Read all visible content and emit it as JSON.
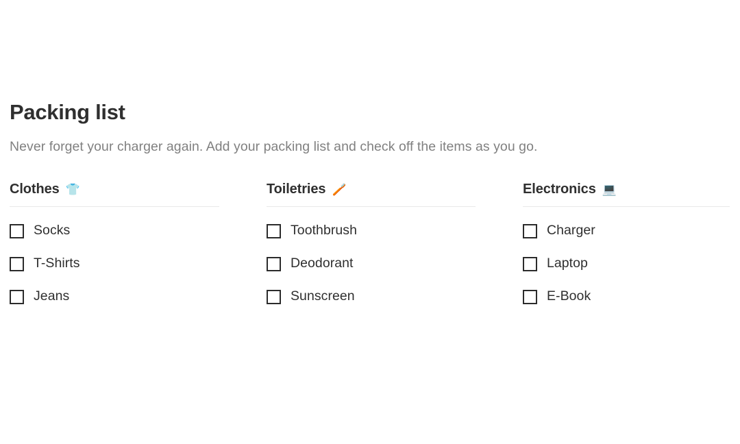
{
  "page": {
    "title": "Packing list",
    "subtitle": "Never forget your charger again. Add your packing list and check off the items as you go."
  },
  "theme": {
    "background": "#ffffff",
    "title_color": "#2f2f2f",
    "subtitle_color": "#808080",
    "divider_color": "#e8e8e8",
    "checkbox_border_color": "#2b2b2b"
  },
  "columns": [
    {
      "title": "Clothes",
      "emoji": "👕",
      "emoji_name": "t-shirt-icon",
      "items": [
        {
          "label": "Socks",
          "checked": false
        },
        {
          "label": "T-Shirts",
          "checked": false
        },
        {
          "label": "Jeans",
          "checked": false
        }
      ]
    },
    {
      "title": "Toiletries",
      "emoji": "🪥",
      "emoji_name": "toothbrush-icon",
      "items": [
        {
          "label": "Toothbrush",
          "checked": false
        },
        {
          "label": "Deodorant",
          "checked": false
        },
        {
          "label": "Sunscreen",
          "checked": false
        }
      ]
    },
    {
      "title": "Electronics",
      "emoji": "💻",
      "emoji_name": "laptop-icon",
      "items": [
        {
          "label": "Charger",
          "checked": false
        },
        {
          "label": "Laptop",
          "checked": false
        },
        {
          "label": "E-Book",
          "checked": false
        }
      ]
    }
  ]
}
